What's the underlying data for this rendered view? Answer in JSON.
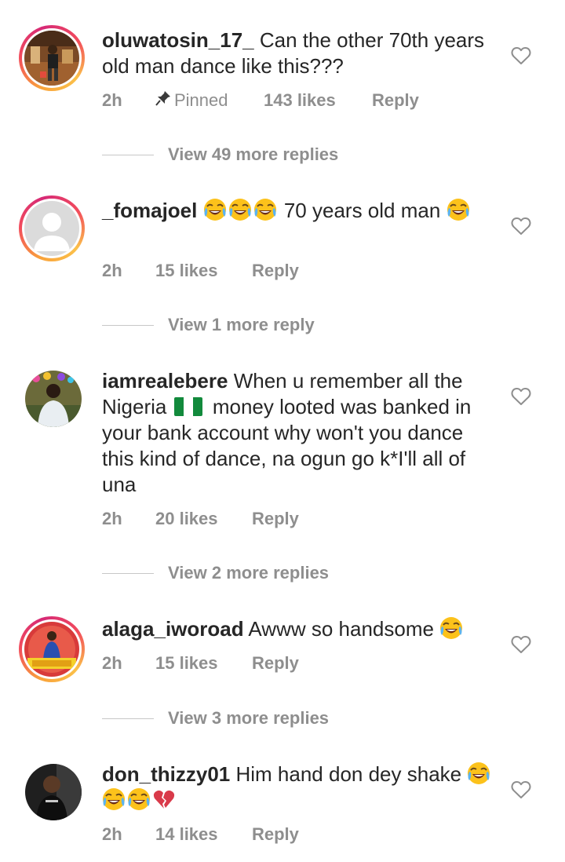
{
  "comments": [
    {
      "username": "oluwatosin_17_",
      "text": "Can the other 70th years old man dance like this???",
      "time": "2h",
      "pinned_label": "Pinned",
      "likes": "143 likes",
      "reply_label": "Reply",
      "view_more": "View 49 more replies",
      "avatar_icon": "photo-avatar-dancer"
    },
    {
      "username": "_fomajoel",
      "text": "70 years old man",
      "time": "2h",
      "likes": "15 likes",
      "reply_label": "Reply",
      "view_more": "View 1 more reply",
      "avatar_icon": "default-profile-avatar"
    },
    {
      "username": "iamrealebere",
      "text_part1": "When u remember all the Nigeria",
      "text_part2": "money looted was banked in your bank account why won't you dance this kind of dance, na ogun go k*I'll all of una",
      "time": "2h",
      "likes": "20 likes",
      "reply_label": "Reply",
      "view_more": "View 2 more replies",
      "avatar_icon": "photo-avatar-woman"
    },
    {
      "username": "alaga_iworoad",
      "text": "Awww so handsome",
      "time": "2h",
      "likes": "15 likes",
      "reply_label": "Reply",
      "view_more": "View 3 more replies",
      "avatar_icon": "photo-avatar-alaga"
    },
    {
      "username": "don_thizzy01",
      "text": "Him hand don dey shake",
      "time": "2h",
      "likes": "14 likes",
      "reply_label": "Reply",
      "avatar_icon": "photo-avatar-man"
    }
  ],
  "colors": {
    "text": "#262626",
    "muted": "#8e8e8e",
    "divider": "#c7c7c7"
  }
}
